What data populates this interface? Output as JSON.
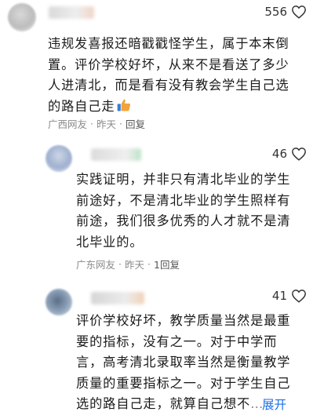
{
  "comments": [
    {
      "likes": "556",
      "text": "违规发喜报还暗戳戳怪学生，属于本末倒置。评价学校好坏，从来不是看送了多少人进清北，而是看有没有教会学生自己选的路自己走",
      "emoji": "thumbs-up-icon",
      "location": "广西网友",
      "time": "昨天",
      "reply": "回复"
    },
    {
      "likes": "46",
      "text": "实践证明，并非只有清北毕业的学生前途好，不是清北毕业的学生照样有前途，我们很多优秀的人才就不是清北毕业的。",
      "location": "广东网友",
      "time": "昨天",
      "reply": "1回复"
    },
    {
      "likes": "41",
      "text": "评价学校好坏，教学质量当然是最重要的指标，没有之一。对于中学而言，高考清北录取率当然是衡量教学质量的重要指标之一。对于学生自己选的路自己走，就算自己想不",
      "ellipsis": "…",
      "expand": "展开"
    }
  ],
  "colors": {
    "expand": "#1b6fe8",
    "meta": "#8a8a8a",
    "thumb": "#f2a33a"
  }
}
